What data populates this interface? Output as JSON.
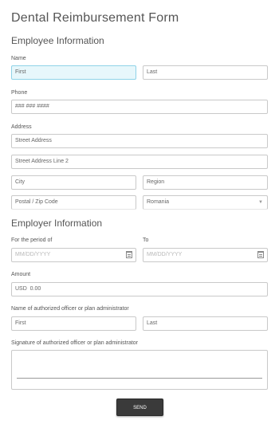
{
  "form": {
    "title": "Dental Reimbursement Form"
  },
  "employee": {
    "heading": "Employee Information",
    "name_label": "Name",
    "first_value": "First",
    "last_value": "Last",
    "phone_label": "Phone",
    "phone_value": "### ### ####",
    "address_label": "Address",
    "street_value": "Street Address",
    "street2_value": "Street Address Line 2",
    "city_value": "City",
    "region_value": "Region",
    "postal_value": "Postal / Zip Code",
    "country_value": "Romania"
  },
  "employer": {
    "heading": "Employer Information",
    "period_label": "For the period of",
    "to_label": "To",
    "date_from_placeholder": "MM/DD/YYYY",
    "date_to_placeholder": "MM/DD/YYYY",
    "amount_label": "Amount",
    "amount_value": "USD  0.00",
    "officer_label": "Name of authorized officer or plan administrator",
    "officer_first": "First",
    "officer_last": "Last",
    "signature_label": "Signature of authorized officer or plan administrator"
  },
  "actions": {
    "send_label": "SEND"
  }
}
